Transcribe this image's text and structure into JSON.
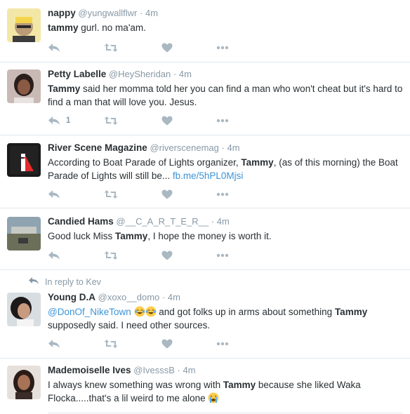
{
  "tweets": [
    {
      "name": "nappy",
      "handle": "@yungwallflwr",
      "sep": "·",
      "time": "4m",
      "segments": [
        {
          "t": "tammy",
          "b": true
        },
        {
          "t": " gurl. no ma'am."
        }
      ],
      "reply_count": ""
    },
    {
      "name": "Petty Labelle",
      "handle": "@HeySheridan",
      "sep": "·",
      "time": "4m",
      "segments": [
        {
          "t": "Tammy",
          "b": true
        },
        {
          "t": " said her momma told her you can find a man who won't cheat but it's hard to find a man that will love you. Jesus."
        }
      ],
      "reply_count": "1"
    },
    {
      "name": "River Scene Magazine",
      "handle": "@riverscenemag",
      "sep": "·",
      "time": "4m",
      "segments": [
        {
          "t": "According to Boat Parade of Lights organizer, "
        },
        {
          "t": "Tammy",
          "b": true
        },
        {
          "t": ", (as of this morning) the Boat Parade of Lights will still be... "
        },
        {
          "t": "fb.me/5hPL0Mjsi",
          "link": true
        }
      ],
      "reply_count": ""
    },
    {
      "name": "Candied Hams",
      "handle": "@__C_A_R_T_E_R__",
      "sep": "·",
      "time": "4m",
      "segments": [
        {
          "t": "Good luck Miss "
        },
        {
          "t": "Tammy",
          "b": true
        },
        {
          "t": ", I hope the money is worth it."
        }
      ],
      "reply_count": ""
    },
    {
      "context": "In reply to Kev",
      "name": "Young D.A",
      "handle": "@xoxo__domo",
      "sep": "·",
      "time": "4m",
      "segments": [
        {
          "t": "@DonOf_NikeTown",
          "link": true
        },
        {
          "t": " "
        },
        {
          "emoji": "joy"
        },
        {
          "emoji": "joy"
        },
        {
          "t": " and got folks up in arms about something "
        },
        {
          "t": "Tammy",
          "b": true
        },
        {
          "t": " supposedly said. I need other sources."
        }
      ],
      "reply_count": ""
    },
    {
      "name": "Mademoiselle Ives",
      "handle": "@IvesssB",
      "sep": "·",
      "time": "4m",
      "segments": [
        {
          "t": "I always knew something was wrong with "
        },
        {
          "t": "Tammy",
          "b": true
        },
        {
          "t": " because she liked Waka Flocka.....that's a lil weird to me alone "
        },
        {
          "emoji": "sob"
        }
      ],
      "reply_count": ""
    }
  ],
  "icons": {
    "reply": "reply-icon",
    "retweet": "retweet-icon",
    "like": "heart-icon",
    "more": "more-icon",
    "context": "reply-arrow-icon"
  },
  "colors": {
    "action_icon": "#aab8c2",
    "meta_text": "#8899a6",
    "link": "#3b94d9",
    "border": "#e1e8ed"
  }
}
